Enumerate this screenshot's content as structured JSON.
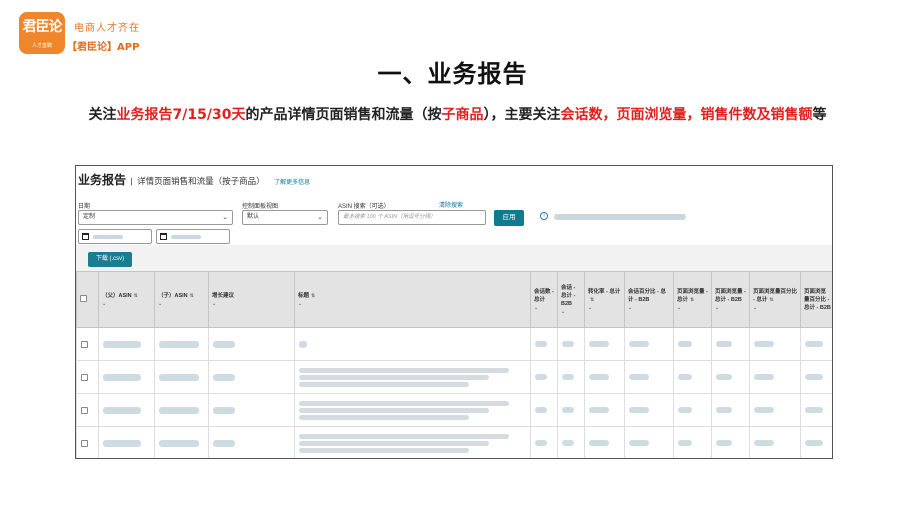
{
  "brand": {
    "logo_text": "君臣论",
    "logo_tagline": "人才直聘",
    "slogan": "电商人才齐在",
    "app_name": "【君臣论】APP"
  },
  "slide": {
    "title": "一、业务报告",
    "desc_parts": [
      {
        "text": "关注",
        "red": false
      },
      {
        "text": "业务报告7/15/30天",
        "red": true
      },
      {
        "text": "的产品详情页面销售和流量（按",
        "red": false
      },
      {
        "text": "子商品",
        "red": true
      },
      {
        "text": "），主要关注",
        "red": false
      },
      {
        "text": "会话数，页面浏览量，销售件数及销售额",
        "red": true
      },
      {
        "text": "等",
        "red": false
      }
    ]
  },
  "report": {
    "title": "业务报告",
    "separator": "|",
    "subtitle": "详情页面销售和流量（按子商品）",
    "more_link": "了解更多信息",
    "date_label": "日期",
    "date_value": "定制",
    "dashboard_label": "控制面板视图",
    "dashboard_value": "默认",
    "asin_label": "ASIN 搜索（可选）",
    "clear_search": "清除搜索",
    "asin_placeholder": "最多搜索 100 个 ASIN（用逗号分隔）",
    "apply_button": "应用",
    "download_button": "下载 (.csv)",
    "columns": [
      "（父）ASIN",
      "（子）ASIN",
      "增长建议",
      "标题",
      "会话数 - 总计",
      "会话 - 总计 - B2B",
      "转化率 - 总计",
      "会话百分比 - 总计 - B2B",
      "页面浏览量 - 总计",
      "页面浏览量 - 总计 - B2B",
      "页面浏览量百分比 - 总计",
      "页面浏览量百分比 - 总计 - B2B"
    ],
    "row_count": 4
  },
  "colors": {
    "accent_red": "#e02020",
    "brand_orange": "#f0862b",
    "button_teal": "#0d7b90"
  }
}
